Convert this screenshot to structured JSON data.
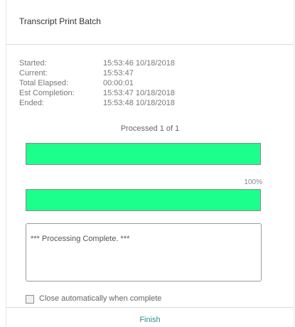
{
  "dialog": {
    "title": "Transcript Print Batch",
    "stats": [
      {
        "label": "Started:",
        "value": "15:53:46 10/18/2018"
      },
      {
        "label": "Current:",
        "value": "15:53:47"
      },
      {
        "label": "Total Elapsed:",
        "value": "00:00:01"
      },
      {
        "label": "Est Completion:",
        "value": "15:53:47 10/18/2018"
      },
      {
        "label": "Ended:",
        "value": "15:53:48 10/18/2018"
      }
    ],
    "processed_text": "Processed 1 of 1",
    "item_progress": 1.0,
    "overall_progress": 1.0,
    "overall_percent_label": "100%",
    "log_text": "*** Processing Complete. ***",
    "close_auto_label": "Close automatically when complete",
    "close_auto_checked": false,
    "finish_label": "Finish"
  },
  "colors": {
    "progress_fill": "#1cff8d",
    "finish_link": "#2f8f8a"
  }
}
